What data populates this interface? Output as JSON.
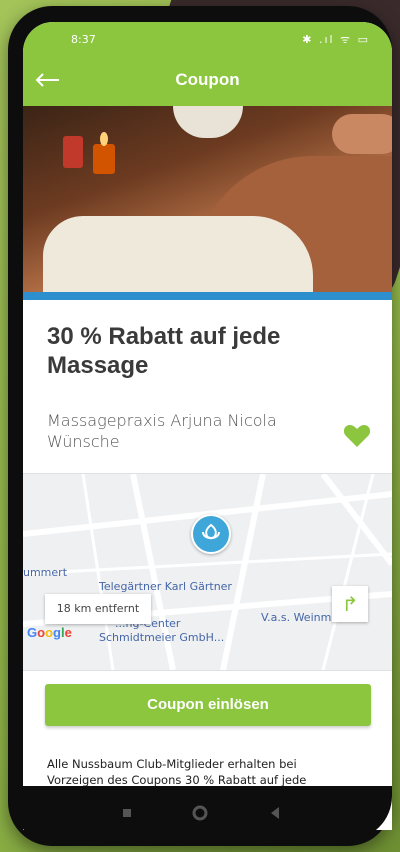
{
  "status_bar": {
    "time": "8:37",
    "icons_text": "✱ .ıl ᯤ ▭"
  },
  "app_bar": {
    "title": "Coupon",
    "back_icon": "arrow-back-icon"
  },
  "coupon": {
    "headline": "30 % Rabatt auf jede Massage",
    "merchant": "Massagepraxis Arjuna Nicola Wünsche",
    "favorite_color": "#8cc63f"
  },
  "map": {
    "distance": "18 km entfernt",
    "pois": [
      "ummert",
      "Telegärtner Karl Gärtner",
      "V.a.s. Weinm",
      "Schmidtmeier GmbH..."
    ],
    "street_partial": "...ng-Center",
    "logo_text": "Google"
  },
  "cta": {
    "label": "Coupon einlösen"
  },
  "description": "Alle Nussbaum Club-Mitglieder erhalten bei Vorzeigen des Coupons 30 % Rabatt auf jede Massage.",
  "colors": {
    "brand_green": "#8cc63f",
    "accent_blue": "#2e8fcf"
  }
}
